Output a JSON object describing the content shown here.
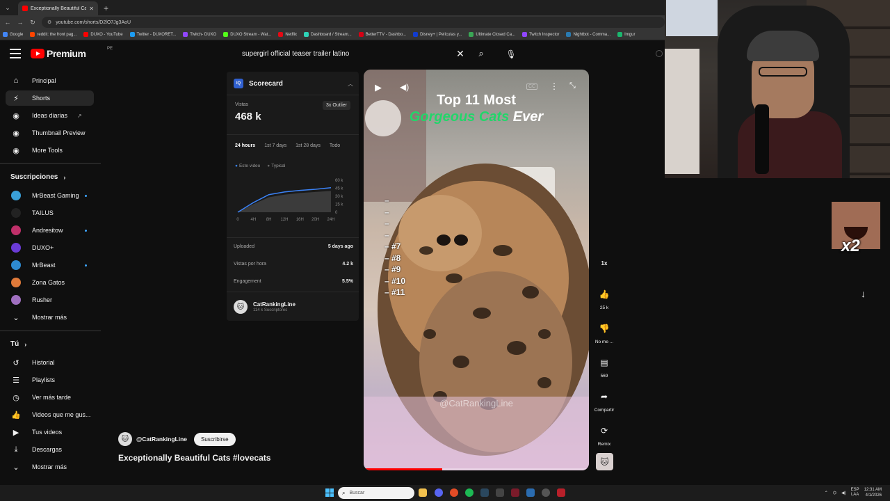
{
  "browser": {
    "tab_title": "Exceptionally Beautiful Cats #lo",
    "new_tab": "+",
    "url": "youtube.com/shorts/D2lO7Jg3AoU",
    "bookmarks": [
      {
        "label": "Google",
        "color": "#4285f4"
      },
      {
        "label": "reddit: the front pag...",
        "color": "#ff4500"
      },
      {
        "label": "DUXO - YouTube",
        "color": "#ff0000"
      },
      {
        "label": "Twitter - DUXORET...",
        "color": "#1d9bf0"
      },
      {
        "label": "Twitch- DUXO",
        "color": "#9146ff"
      },
      {
        "label": "DUXO Stream - Wat...",
        "color": "#53fc18"
      },
      {
        "label": "Netflix",
        "color": "#e50914"
      },
      {
        "label": "Dashboard / Stream...",
        "color": "#2ed3b7"
      },
      {
        "label": "BetterTTV - Dashbo...",
        "color": "#d50014"
      },
      {
        "label": "Disney+ | Películas y...",
        "color": "#113ccf"
      },
      {
        "label": "Ultimate Closed Ca...",
        "color": "#3aa655"
      },
      {
        "label": "Twitch Inspector",
        "color": "#9146ff"
      },
      {
        "label": "Nightbot - Comma...",
        "color": "#2a7ab0"
      },
      {
        "label": "Imgur",
        "color": "#1bb76e"
      }
    ]
  },
  "header": {
    "brand": "Premium",
    "region": "PE",
    "search_query": "supergirl official teaser trailer latino"
  },
  "sidebar": {
    "main": [
      {
        "label": "Principal",
        "icon": "home-icon"
      },
      {
        "label": "Shorts",
        "icon": "shorts-icon"
      },
      {
        "label": "Ideas diarias",
        "icon": "ideas-icon"
      },
      {
        "label": "Thumbnail Preview",
        "icon": "thumbnail-icon"
      },
      {
        "label": "More Tools",
        "icon": "tools-icon"
      }
    ],
    "subs_title": "Suscripciones",
    "subs": [
      {
        "label": "MrBeast Gaming",
        "color": "#3aa0d8",
        "live": true
      },
      {
        "label": "TAILUS",
        "color": "#222222",
        "live": false
      },
      {
        "label": "Andresitow",
        "color": "#c0306a",
        "live": true
      },
      {
        "label": "DUXO+",
        "color": "#6a3bd6",
        "live": false
      },
      {
        "label": "MrBeast",
        "color": "#2e8ad0",
        "live": true
      },
      {
        "label": "Zona Gatos",
        "color": "#e07a3a",
        "live": false
      },
      {
        "label": "Rusher",
        "color": "#a070c0",
        "live": false
      }
    ],
    "show_more": "Mostrar más",
    "you_title": "Tú",
    "you": [
      {
        "label": "Historial",
        "icon": "history-icon"
      },
      {
        "label": "Playlists",
        "icon": "playlists-icon"
      },
      {
        "label": "Ver más tarde",
        "icon": "watch-later-icon"
      },
      {
        "label": "Videos que me gus...",
        "icon": "liked-icon"
      },
      {
        "label": "Tus videos",
        "icon": "your-videos-icon"
      },
      {
        "label": "Descargas",
        "icon": "downloads-icon"
      }
    ],
    "you_more": "Mostrar más"
  },
  "scorecard": {
    "logo": "IQ",
    "title": "Scorecard",
    "views_label": "Vistas",
    "views": "468 k",
    "outlier": "3x Outlier",
    "tabs": [
      "24 hours",
      "1st 7 days",
      "1st 28 days",
      "Todo"
    ],
    "legend": [
      "Este video",
      "Typical"
    ],
    "stats": [
      {
        "k": "Uploaded",
        "v": "5 days ago"
      },
      {
        "k": "Vistas por hora",
        "v": "4.2 k"
      },
      {
        "k": "Engagement",
        "v": "5.5%"
      }
    ],
    "channel": "CatRankingLine",
    "channel_subs": "114 k Suscriptores"
  },
  "chart_data": {
    "type": "area",
    "x": [
      "0",
      "4H",
      "8H",
      "12H",
      "16H",
      "20H",
      "24H"
    ],
    "series": [
      {
        "name": "Este video",
        "values": [
          0,
          18,
          33,
          38,
          41,
          43,
          46
        ]
      },
      {
        "name": "Typical",
        "values": [
          0,
          15,
          28,
          33,
          36,
          38,
          40
        ]
      }
    ],
    "y_ticks": [
      "60 k",
      "45 k",
      "30 k",
      "15 k",
      "0"
    ],
    "ylim": [
      0,
      60
    ],
    "colors": {
      "this": "#3b82f6",
      "typical": "#4a4a4a"
    }
  },
  "video": {
    "title_line1": "Top 11 Most",
    "title_line2_green": "Gorgeous Cats",
    "title_line2_white": "Ever",
    "ranks": [
      "–",
      "–",
      "–",
      "–",
      "– #7",
      "– #8",
      "– #9",
      "– #10",
      "– #11"
    ],
    "watermark": "@CatRankingLine",
    "progress": 0.35
  },
  "short_meta": {
    "handle": "@CatRankingLine",
    "subscribe": "Suscribirse",
    "title": "Exceptionally Beautiful Cats #lovecats"
  },
  "actions": {
    "speed": "1x",
    "likes": "25 k",
    "dislike": "No me ...",
    "comments": "569",
    "share": "Compartir",
    "remix": "Remix"
  },
  "overlay": {
    "emote_text": "x2"
  },
  "taskbar": {
    "search_placeholder": "Buscar",
    "lang1": "ESP",
    "lang2": "LAA",
    "time": "12:31 AM",
    "date": "4/1/2026"
  }
}
